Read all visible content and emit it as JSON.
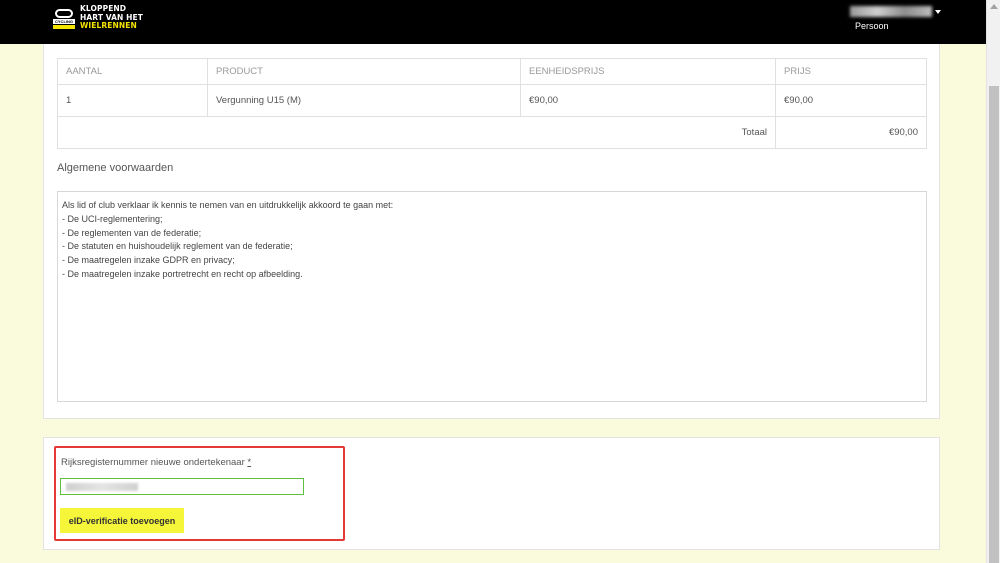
{
  "header": {
    "logo": {
      "line1": "KLOPPEND",
      "line2": "HART VAN HET",
      "line3": "WIELRENNEN",
      "mark_text": "CYCLING"
    },
    "user": {
      "role": "Persoon"
    }
  },
  "order_table": {
    "columns": [
      "AANTAL",
      "PRODUCT",
      "EENHEIDSPRIJS",
      "PRIJS"
    ],
    "rows": [
      {
        "quantity": "1",
        "product": "Vergunning U15 (M)",
        "unit_price": "€90,00",
        "price": "€90,00"
      }
    ],
    "total_label": "Totaal",
    "total_value": "€90,00"
  },
  "terms": {
    "title": "Algemene voorwaarden",
    "intro": "Als lid of club verklaar ik kennis te nemen van en uitdrukkelijk akkoord te gaan met:",
    "items": [
      " - De UCI-reglementering;",
      "- De reglementen van de federatie;",
      "- De statuten en huishoudelijk reglement van de federatie;",
      "- De maatregelen inzake GDPR en privacy;",
      "- De maatregelen inzake portretrecht en recht op afbeelding."
    ]
  },
  "form": {
    "rrn_label": "Rijksregisternummer nieuwe ondertekenaar",
    "required_marker": "*",
    "eid_button_label": "eID-verificatie toevoegen"
  },
  "colors": {
    "header_bg": "#000000",
    "page_bg": "#fafadc",
    "accent_yellow": "#f5f53a",
    "input_border": "#5fbf3f",
    "highlight": "#e53935"
  }
}
